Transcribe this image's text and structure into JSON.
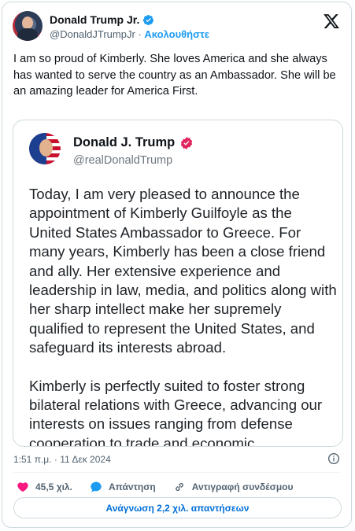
{
  "author": {
    "display_name": "Donald Trump Jr.",
    "handle": "@DonaldJTrumpJr",
    "separator": "·",
    "follow_label": "Ακολουθήστε"
  },
  "tweet": {
    "text": "I am so proud of Kimberly. She loves America and she always has wanted to serve the country as an Ambassador.  She will be an amazing leader for America First."
  },
  "embedded_post": {
    "display_name": "Donald J. Trump",
    "handle": "@realDonaldTrump",
    "paragraphs": [
      "Today, I am very pleased to announce the appointment of Kimberly Guilfoyle as the United States Ambassador to Greece. For many years, Kimberly has been a close friend and ally. Her extensive experience and leadership in law, media, and politics along with her sharp intellect make her supremely qualified to represent the United States, and safeguard its interests abroad.",
      "Kimberly is perfectly suited to foster strong bilateral relations with Greece, advancing our interests on issues ranging from defense cooperation to trade and economic"
    ]
  },
  "meta": {
    "timestamp": "1:51 π.μ. · 11 Δεκ 2024"
  },
  "actions": {
    "like_count": "45,5 χιλ.",
    "reply_label": "Απάντηση",
    "copy_link_label": "Αντιγραφή συνδέσμου"
  },
  "read_replies_label": "Ανάγνωση 2,2 χιλ. απαντήσεων",
  "colors": {
    "accent_blue": "#1d9bf0",
    "like_red": "#f91880",
    "truth_badge_red": "#e0245e"
  },
  "icons": [
    "verified-badge-icon",
    "x-logo-icon",
    "verified-check-icon",
    "info-icon",
    "heart-icon",
    "reply-bubble-icon",
    "link-icon"
  ]
}
